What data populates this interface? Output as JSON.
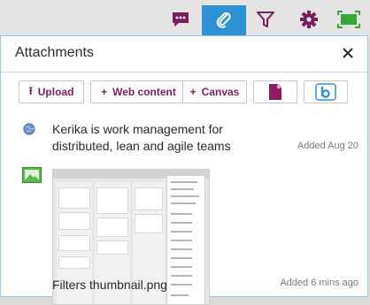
{
  "toolbar": {
    "icons": [
      "chat-icon",
      "paperclip-icon",
      "filter-icon",
      "gear-icon",
      "expand-icon"
    ],
    "active": "paperclip-icon",
    "colors": {
      "accent": "#7a1f5e",
      "active_bg": "#2e92d4",
      "expand": "#3aa63a"
    }
  },
  "panel": {
    "title": "Attachments",
    "close_icon": "close-icon"
  },
  "buttons": {
    "upload": {
      "label": "Upload",
      "glyph": "⭱"
    },
    "web_content": {
      "label": "Web content",
      "glyph": "+"
    },
    "canvas": {
      "label": "Canvas",
      "glyph": "+"
    },
    "google_doc_icon": "document-icon",
    "box_icon": "box-icon"
  },
  "attachments": [
    {
      "icon": "globe-icon",
      "title_line1": "Kerika is work management for",
      "title_line2": "distributed, lean and agile teams",
      "date": "Added Aug 20"
    },
    {
      "icon": "image-icon",
      "title": "Filters thumbnail.png",
      "date": "Added 6 mins ago"
    }
  ]
}
